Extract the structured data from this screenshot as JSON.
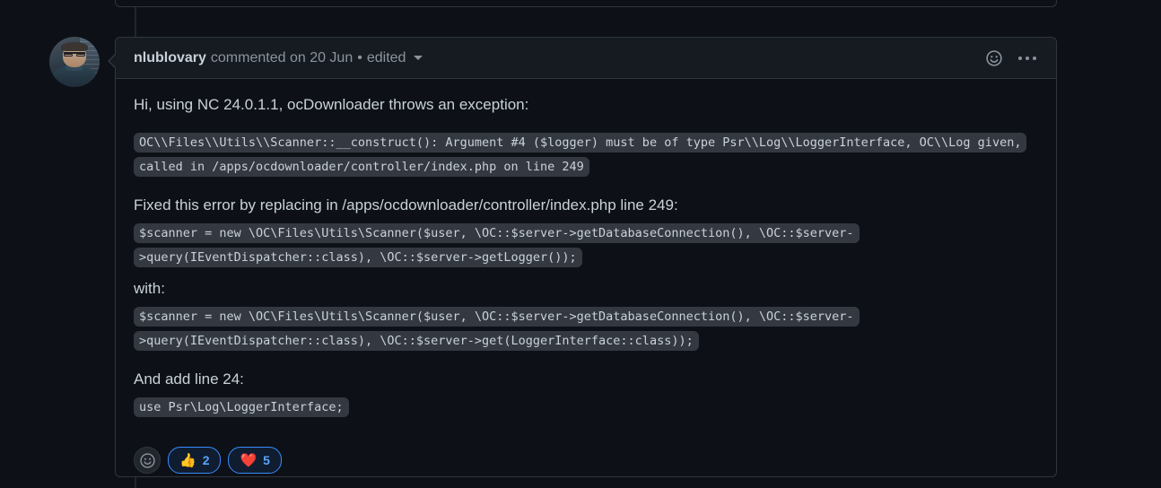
{
  "comment": {
    "author": "nlublovary",
    "action_text": "commented on 20 Jun",
    "separator": "•",
    "edited_label": "edited",
    "avatar_alt": "nlublovary avatar",
    "header_icons": {
      "reaction_icon": "smiley-icon",
      "menu_icon": "kebab-menu-icon"
    },
    "body": {
      "intro_paragraph": "Hi, using NC 24.0.1.1, ocDownloader throws an exception:",
      "error_code": "OC\\\\Files\\\\Utils\\\\Scanner::__construct(): Argument #4 ($logger) must be of type Psr\\\\Log\\\\LoggerInterface, OC\\\\Log given, called in /apps/ocdownloader/controller/index.php on line 249",
      "fix_paragraph": "Fixed this error by replacing in /apps/ocdownloader/controller/index.php line 249:",
      "old_code": "$scanner = new \\OC\\Files\\Utils\\Scanner($user, \\OC::$server->getDatabaseConnection(), \\OC::$server->query(IEventDispatcher::class), \\OC::$server->getLogger());",
      "with_label": "with:",
      "new_code": "$scanner = new \\OC\\Files\\Utils\\Scanner($user, \\OC::$server->getDatabaseConnection(), \\OC::$server->query(IEventDispatcher::class), \\OC::$server->get(LoggerInterface::class));",
      "add_line_paragraph": "And add line 24:",
      "use_statement_code": "use Psr\\Log\\LoggerInterface;"
    },
    "reactions": {
      "add_reaction_icon": "smiley-icon",
      "items": [
        {
          "emoji": "👍",
          "name": "thumbs-up",
          "count": "2",
          "reacted": true
        },
        {
          "emoji": "❤️",
          "name": "heart",
          "count": "5",
          "reacted": true
        }
      ]
    }
  },
  "theme": {
    "page_background": "#0d1117",
    "comment_border": "#30363d",
    "header_background": "#161b22",
    "text_primary": "#c9d1d9",
    "text_muted": "#8b949e",
    "code_background": "#343941",
    "accent_blue": "#58a6ff",
    "reaction_border": "#388bfd"
  }
}
